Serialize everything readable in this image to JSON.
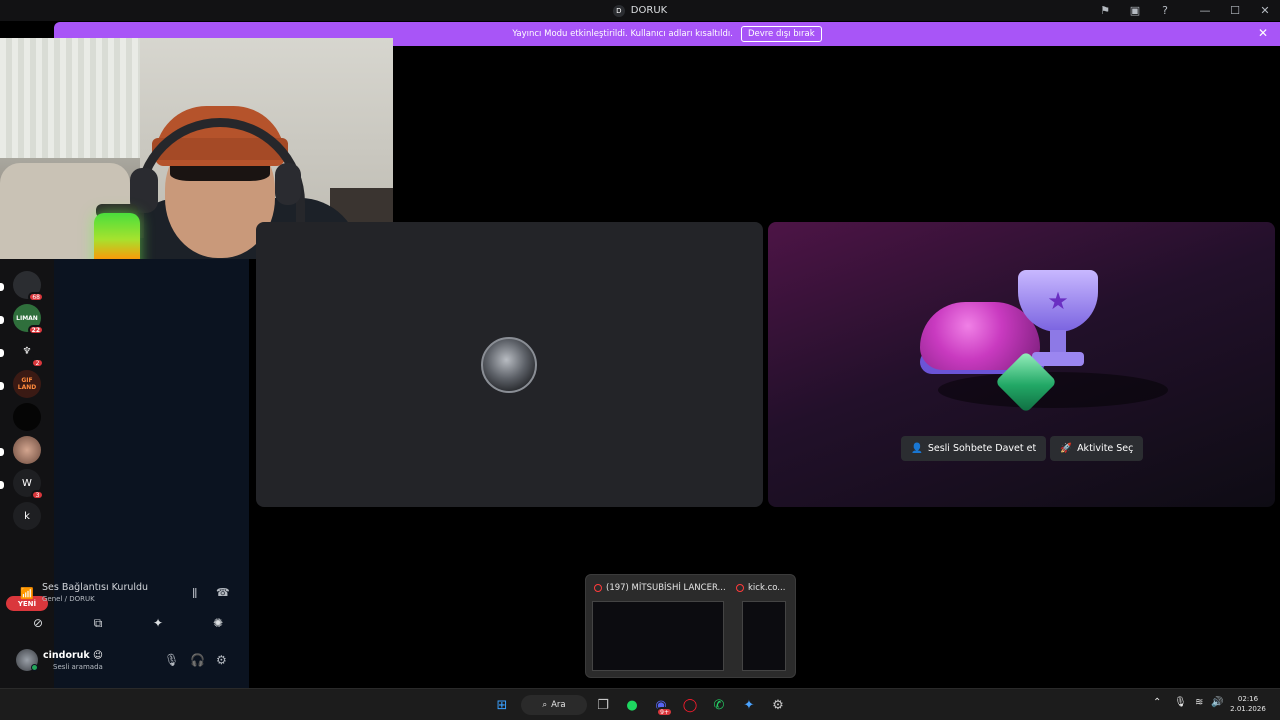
{
  "window": {
    "title": "DORUK",
    "avatar_letter": "D"
  },
  "banner": {
    "message": "Yayıncı Modu etkinleştirildi. Kullanıcı adları kısaltıldı.",
    "button_label": "Devre dışı bırak"
  },
  "guilds": [
    {
      "label": "",
      "badge": "68"
    },
    {
      "label": "LIMAN",
      "badge": "22"
    },
    {
      "label": "",
      "badge": "2"
    },
    {
      "label": "GIF LAND",
      "badge": ""
    },
    {
      "label": "",
      "badge": ""
    },
    {
      "label": "",
      "badge": ""
    },
    {
      "label": "W",
      "badge": "3"
    },
    {
      "label": "k",
      "badge": ""
    }
  ],
  "rail": {
    "new_label": "YENİ"
  },
  "activity": {
    "invite_label": "Sesli Sohbete Davet et",
    "activity_label": "Aktivite Seç"
  },
  "voice_panel": {
    "status": "Ses Bağlantısı Kuruldu",
    "channel": "Genel / DORUK"
  },
  "user": {
    "name": "cindoruk 😉",
    "status": "Sesli aramada"
  },
  "preview": {
    "window1_title": "(197) MİTSUBİSHİ LANCER...",
    "window2_title": "kick.co..."
  },
  "taskbar": {
    "search_label": "Ara",
    "chat_badge": "9+",
    "time": "02:16",
    "date": "2.01.2026"
  },
  "colors": {
    "banner": "#a855f7",
    "danger": "#da373c",
    "online": "#23a55a"
  }
}
